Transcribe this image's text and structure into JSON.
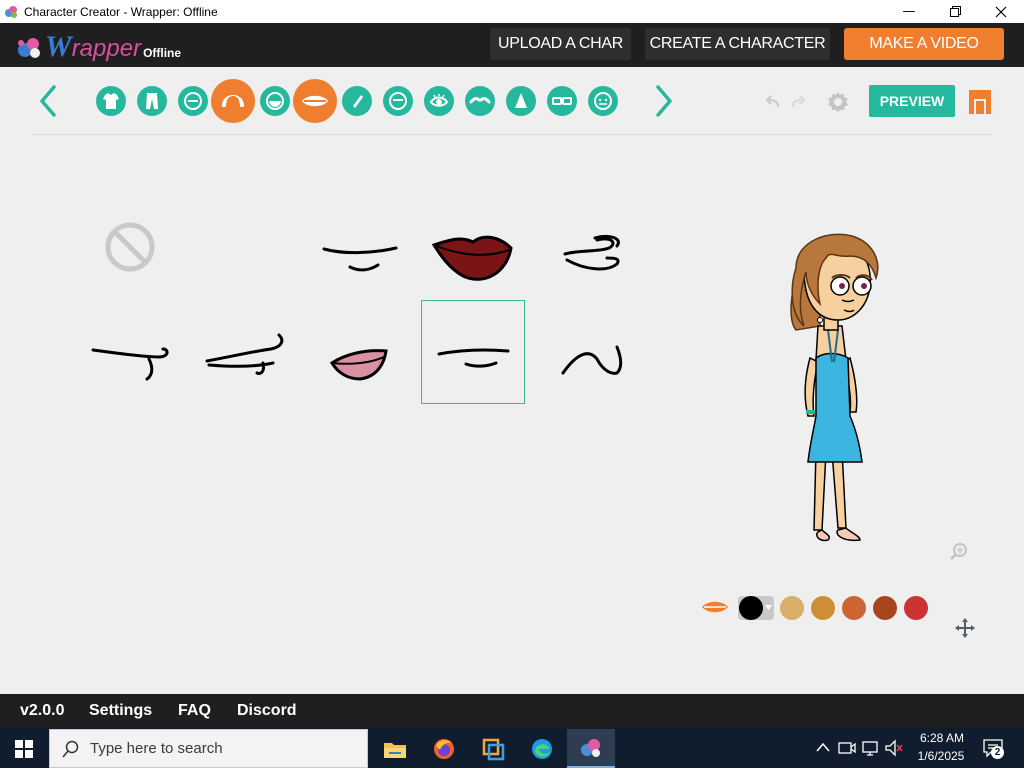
{
  "window": {
    "title": "Character Creator - Wrapper: Offline"
  },
  "header": {
    "logo_w": "W",
    "logo_rapper": "rapper",
    "logo_offline": "Offline",
    "upload_label": "UPLOAD A CHAR",
    "create_label": "CREATE A CHARACTER",
    "video_label": "MAKE A VIDEO",
    "accent_color": "#f07e2f"
  },
  "toolbar": {
    "categories": [
      "shirt-icon",
      "pants-icon",
      "face-shape-icon",
      "hair-icon",
      "beard-icon",
      "mouth-icon",
      "skin-tone-icon",
      "head-icon",
      "eye-icon",
      "eyebrow-icon",
      "nose-icon",
      "glasses-icon",
      "accessory-face-icon"
    ],
    "selected_category": "mouth-icon",
    "preview_label": "PREVIEW",
    "theme_color": "#26b89d"
  },
  "mouth_options": [
    "none",
    "mouth-smile-flat",
    "mouth-lips-dark-red",
    "mouth-squiggle-1",
    "mouth-hook",
    "mouth-lined",
    "mouth-lips-pink",
    "mouth-selected-flat",
    "mouth-curl"
  ],
  "selected_option": "mouth-selected-flat",
  "colors": {
    "swatches": [
      "#000000",
      "#d9b06a",
      "#cf8e35",
      "#cc6532",
      "#a94421",
      "#cd3232"
    ],
    "selected": "#000000"
  },
  "footer": {
    "version": "v2.0.0",
    "settings": "Settings",
    "faq": "FAQ",
    "discord": "Discord"
  },
  "taskbar": {
    "search_placeholder": "Type here to search",
    "time": "6:28 AM",
    "date": "1/6/2025",
    "notification_count": "2"
  }
}
